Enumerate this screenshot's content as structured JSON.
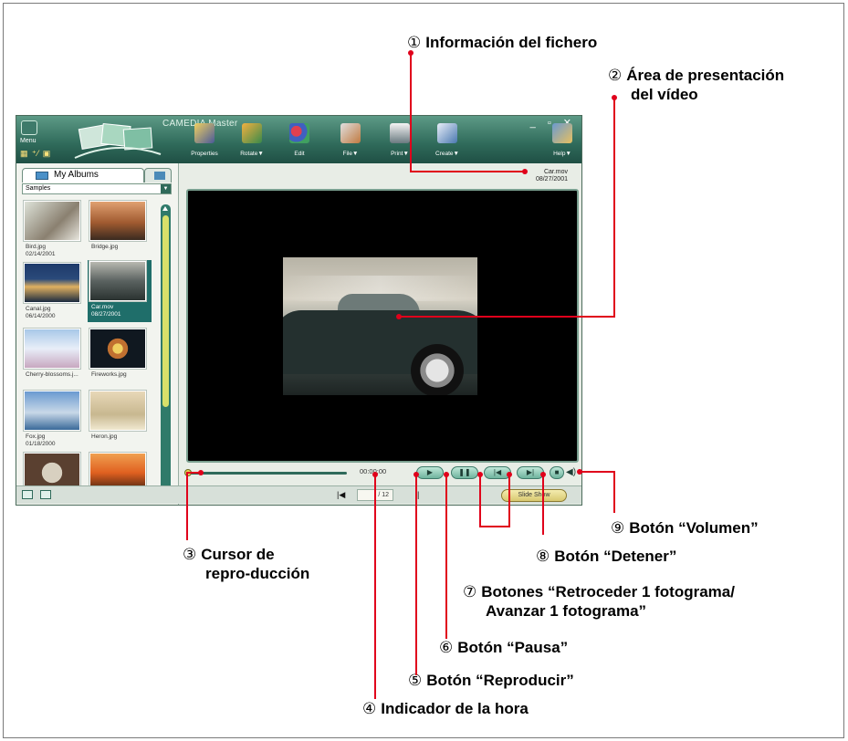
{
  "app": {
    "title": "CAMEDIA Master",
    "menu_label": "Menu",
    "toolbar": [
      {
        "label": "Properties",
        "icon": "properties-icon"
      },
      {
        "label": "Rotate▼",
        "icon": "rotate-icon"
      },
      {
        "label": "Edit",
        "icon": "edit-icon"
      },
      {
        "label": "File▼",
        "icon": "file-icon"
      },
      {
        "label": "Print▼",
        "icon": "print-icon"
      },
      {
        "label": "Create▼",
        "icon": "create-icon"
      },
      {
        "label": "Help▼",
        "icon": "help-icon"
      }
    ],
    "window_controls": "_ ▫ ✕"
  },
  "left_panel": {
    "albums_tab": "My Albums",
    "album_select": "Samples",
    "thumbnails": [
      {
        "name": "Bird.jpg",
        "date": "02/14/2001"
      },
      {
        "name": "Bridge.jpg",
        "date": ""
      },
      {
        "name": "Canal.jpg",
        "date": "06/14/2000"
      },
      {
        "name": "Car.mov",
        "date": "08/27/2001"
      },
      {
        "name": "Cherry-blossoms.j...",
        "date": ""
      },
      {
        "name": "Fireworks.jpg",
        "date": ""
      },
      {
        "name": "Fox.jpg",
        "date": "01/18/2000"
      },
      {
        "name": "Heron.jpg",
        "date": ""
      },
      {
        "name": "",
        "date": ""
      },
      {
        "name": "",
        "date": ""
      }
    ]
  },
  "viewer": {
    "file_name": "Car.mov",
    "file_date": "08/27/2001",
    "time": "00:00:00",
    "page": "/ 12",
    "slideshow": "Slide Show",
    "buttons": {
      "play": "▶",
      "pause": "❚❚",
      "prev": "|◀",
      "next": "▶|",
      "stop": "■",
      "volume": "◀)"
    }
  },
  "annotations": {
    "a1": {
      "num": "①",
      "text": "Información del fichero"
    },
    "a2": {
      "num": "②",
      "line1": "Área de presentación",
      "line2": "del vídeo"
    },
    "a3": {
      "num": "③",
      "line1": "Cursor de",
      "line2": "repro-ducción"
    },
    "a4": {
      "num": "④",
      "text": "Indicador de la hora"
    },
    "a5": {
      "num": "⑤",
      "text": "Botón “Reproducir”"
    },
    "a6": {
      "num": "⑥",
      "text": "Botón “Pausa”"
    },
    "a7": {
      "num": "⑦",
      "line1": "Botones “Retroceder 1 fotograma/",
      "line2": "Avanzar 1 fotograma”"
    },
    "a8": {
      "num": "⑧",
      "text": "Botón “Detener”"
    },
    "a9": {
      "num": "⑨",
      "text": "Botón “Volumen”"
    }
  },
  "colors": {
    "leader_line": "#e0001b",
    "titlebar": "#2f6a5a",
    "accent": "#1f6e6a"
  }
}
